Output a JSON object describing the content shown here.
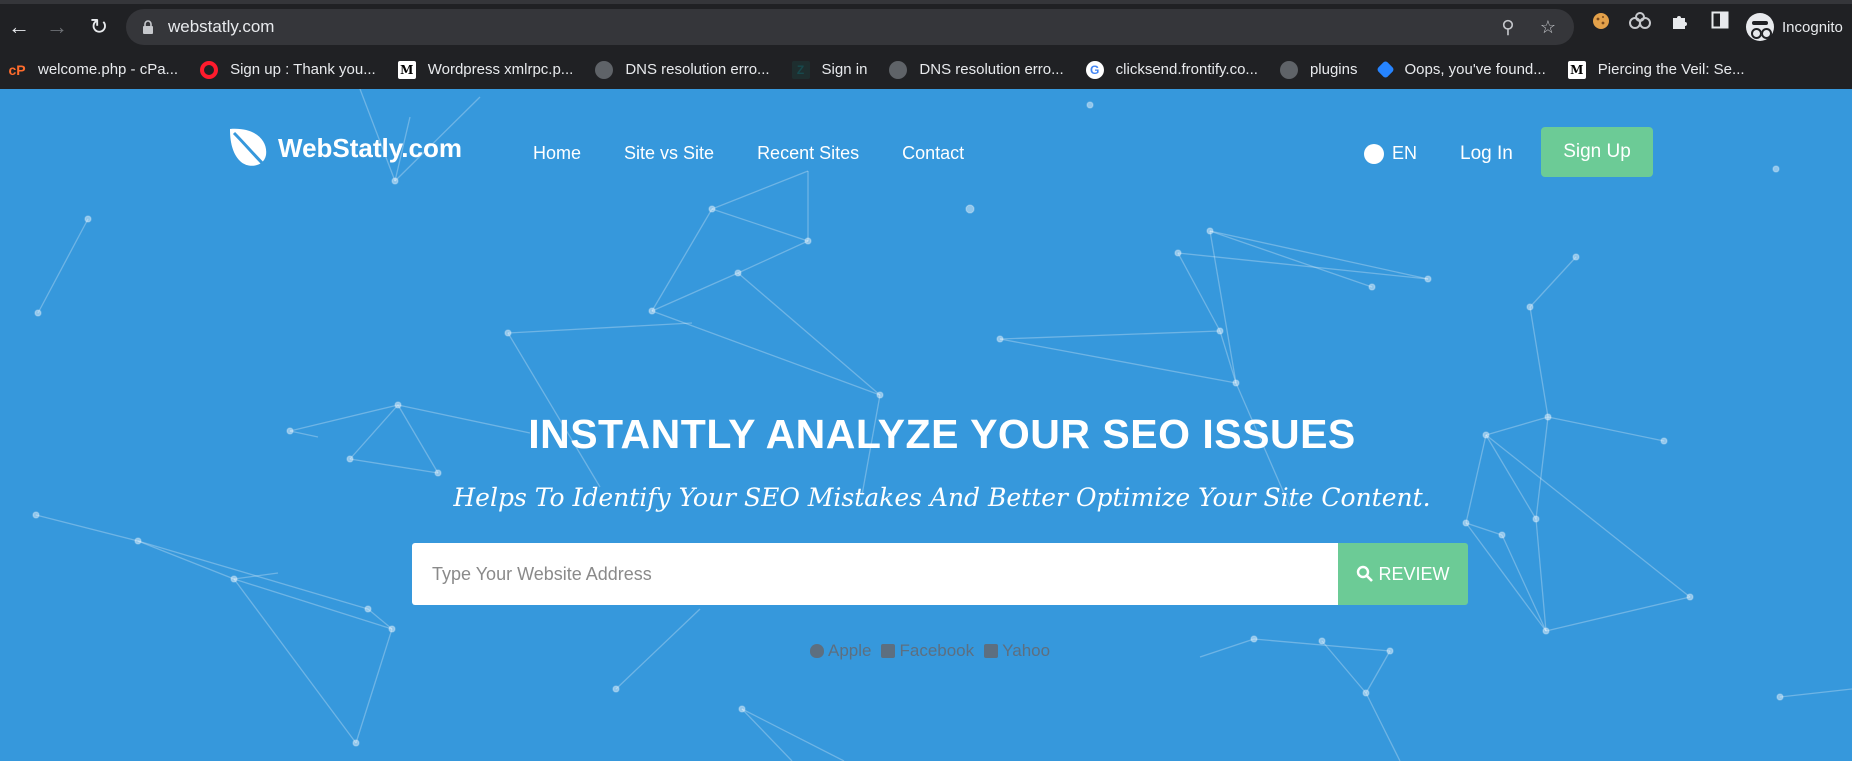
{
  "browser": {
    "url": "webstatly.com",
    "profile_label": "Incognito",
    "bookmarks": [
      {
        "label": "welcome.php - cPa...",
        "icon": "cpanel-icon",
        "color": "#ff6c2c"
      },
      {
        "label": "Sign up : Thank you...",
        "icon": "opera-icon",
        "color": "#ff1b2d"
      },
      {
        "label": "Wordpress xmlrpc.p...",
        "icon": "medium-icon",
        "color": "#ffffff"
      },
      {
        "label": "DNS resolution erro...",
        "icon": "globe-icon",
        "color": "#5f6368"
      },
      {
        "label": "Sign in",
        "icon": "zendesk-icon",
        "color": "#03363d"
      },
      {
        "label": "DNS resolution erro...",
        "icon": "globe-icon",
        "color": "#5f6368"
      },
      {
        "label": "clicksend.frontify.co...",
        "icon": "google-icon",
        "color": "#ffffff"
      },
      {
        "label": "plugins",
        "icon": "globe-icon",
        "color": "#5f6368"
      },
      {
        "label": "Oops, you've found...",
        "icon": "jira-icon",
        "color": "#2684ff"
      },
      {
        "label": "Piercing the Veil: Se...",
        "icon": "medium-icon",
        "color": "#ffffff"
      }
    ]
  },
  "site": {
    "logo_text": "WebStatly.com",
    "nav": [
      "Home",
      "Site vs Site",
      "Recent Sites",
      "Contact"
    ],
    "lang": "EN",
    "login": "Log In",
    "signup": "Sign Up"
  },
  "hero": {
    "headline": "INSTANTLY ANALYZE YOUR SEO ISSUES",
    "subline": "Helps To Identify Your SEO Mistakes And Better Optimize Your Site Content.",
    "search_placeholder": "Type Your Website Address",
    "review_label": "REVIEW",
    "examples": [
      "Apple",
      "Facebook",
      "Yahoo"
    ]
  },
  "colors": {
    "page_bg": "#3698dc",
    "accent_green": "#6ccb96",
    "chrome_bg": "#202124"
  }
}
